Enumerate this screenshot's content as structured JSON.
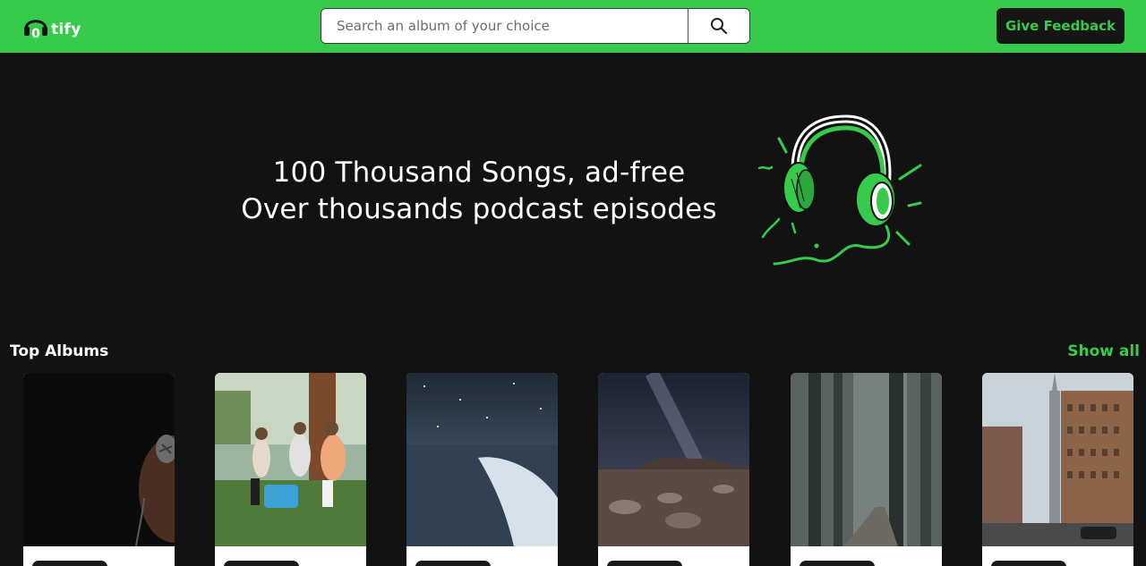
{
  "header": {
    "logo_text": "tify",
    "logo_mark": "0",
    "search_placeholder": "Search an album of your choice",
    "feedback_label": "Give Feedback",
    "colors": {
      "brand": "#36cb4b",
      "dark": "#151515"
    }
  },
  "hero": {
    "line1": "100 Thousand Songs, ad-free",
    "line2": "Over thousands podcast episodes",
    "art_icon": "headphones-illustration"
  },
  "albums_section": {
    "title": "Top Albums",
    "show_all_label": "Show all",
    "albums": [
      {
        "image": "microphone-singer-photo"
      },
      {
        "image": "friends-guitar-forest-photo"
      },
      {
        "image": "starry-snow-landscape-photo"
      },
      {
        "image": "milky-way-desert-photo"
      },
      {
        "image": "misty-forest-photo"
      },
      {
        "image": "city-skyscrapers-photo"
      }
    ]
  }
}
